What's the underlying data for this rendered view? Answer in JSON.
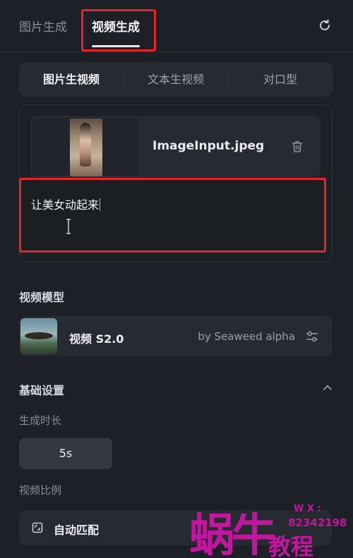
{
  "tabs": [
    {
      "label": "图片生成",
      "active": false
    },
    {
      "label": "视频生成",
      "active": true
    }
  ],
  "mode_tabs": [
    {
      "label": "图片生视频",
      "active": true
    },
    {
      "label": "文本生视频",
      "active": false
    },
    {
      "label": "对口型",
      "active": false
    }
  ],
  "upload": {
    "file_name": "ImageInput.jpeg",
    "prompt": "让美女动起来"
  },
  "video_model": {
    "section_title": "视频模型",
    "name": "视频 S2.0",
    "by": "by Seaweed alpha"
  },
  "basic_settings": {
    "title": "基础设置",
    "duration_label": "生成时长",
    "duration_value": "5s",
    "ratio_label": "视频比例",
    "ratio_value": "自动匹配"
  },
  "watermark": {
    "brand": "蜗牛",
    "sub": "教程",
    "wx_label": "W X :",
    "wx_number": "82342198"
  },
  "colors": {
    "background": "#1d2026",
    "card": "#262a31",
    "highlight_box": "#e5242b",
    "watermark": "#c2169e"
  },
  "icons": [
    "refresh-icon",
    "trash-icon",
    "sliders-icon",
    "chevron-up-icon",
    "aspect-ratio-icon",
    "text-cursor-icon"
  ]
}
